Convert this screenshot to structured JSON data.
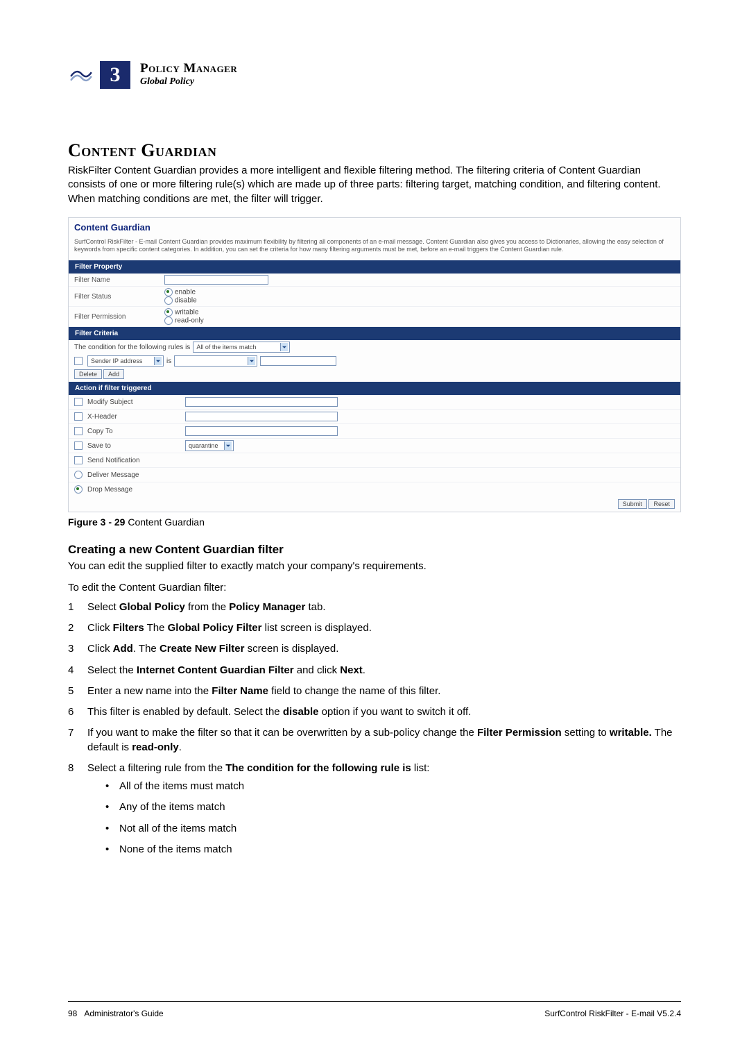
{
  "header": {
    "chapter_number": "3",
    "chapter_title": "Policy Manager",
    "chapter_subtitle": "Global Policy"
  },
  "section_title": "Content Guardian",
  "intro_paragraph": "RiskFilter Content Guardian provides a more intelligent and flexible filtering method. The filtering criteria of Content Guardian consists of one or more filtering rule(s) which are made up of three parts: filtering target, matching condition, and filtering content. When matching conditions are met, the filter will trigger.",
  "screenshot": {
    "title": "Content Guardian",
    "description": "SurfControl RiskFilter - E-mail Content Guardian provides maximum flexibility by filtering all components of an e-mail message. Content Guardian also gives you access to Dictionaries, allowing the easy selection of keywords from specific content categories. In addition, you can set the criteria for how many filtering arguments must be met, before an e-mail triggers the Content Guardian rule.",
    "filter_property_header": "Filter Property",
    "rows": {
      "filter_name_label": "Filter Name",
      "filter_status_label": "Filter Status",
      "status_enable": "enable",
      "status_disable": "disable",
      "filter_permission_label": "Filter Permission",
      "perm_writable": "writable",
      "perm_readonly": "read-only"
    },
    "filter_criteria_header": "Filter Criteria",
    "criteria": {
      "condition_text": "The condition for the following rules is",
      "condition_value": "All of the items match",
      "field_select": "Sender IP address",
      "operator": "is",
      "delete_btn": "Delete",
      "add_btn": "Add"
    },
    "action_header": "Action if filter triggered",
    "actions": {
      "modify_subject": "Modify Subject",
      "x_header": "X-Header",
      "copy_to": "Copy To",
      "save_to": "Save to",
      "save_to_value": "quarantine",
      "send_notification": "Send Notification",
      "deliver_message": "Deliver Message",
      "drop_message": "Drop Message"
    },
    "submit_btn": "Submit",
    "reset_btn": "Reset"
  },
  "figure_caption_bold": "Figure 3 - 29",
  "figure_caption_text": " Content Guardian",
  "subsection_title": "Creating a new Content Guardian filter",
  "subsection_intro": "You can edit the supplied filter to exactly match your company's requirements.",
  "subsection_lead": "To edit the Content Guardian filter:",
  "steps": [
    {
      "pre": "Select ",
      "b": "Global Policy",
      "mid": " from the ",
      "b2": "Policy Manager",
      "post": " tab."
    },
    {
      "pre": "Click ",
      "b": "Filters",
      "mid": " The ",
      "b2": "Global Policy Filter",
      "post": " list screen is displayed."
    },
    {
      "pre": "Click ",
      "b": "Add",
      "mid": ". The ",
      "b2": "Create New Filter",
      "post": " screen is displayed."
    },
    {
      "pre": "Select the ",
      "b": "Internet Content Guardian Filter",
      "mid": " and click ",
      "b2": "Next",
      "post": "."
    },
    {
      "pre": "Enter a new name into the ",
      "b": "Filter Name",
      "mid": " field to change the name of this filter.",
      "b2": "",
      "post": ""
    },
    {
      "pre": "This filter is enabled by default. Select the ",
      "b": "disable",
      "mid": " option if you want to switch it off.",
      "b2": "",
      "post": ""
    },
    {
      "pre": "If you want to make the filter so that it can be overwritten by a sub-policy change the ",
      "b": "Filter Permission",
      "mid": " setting to ",
      "b2": "writable.",
      "post": " The default is ",
      "b3": "read-only",
      "post2": "."
    },
    {
      "pre": "Select a filtering rule from the ",
      "b": "The condition for the following rule is",
      "mid": " list:",
      "b2": "",
      "post": ""
    }
  ],
  "bullets": [
    "All of the items must match",
    "Any of the items match",
    "Not all of the items match",
    "None of the items match"
  ],
  "footer": {
    "page_number": "98",
    "guide_label": "Administrator's Guide",
    "product": "SurfControl RiskFilter - E-mail V5.2.4"
  }
}
